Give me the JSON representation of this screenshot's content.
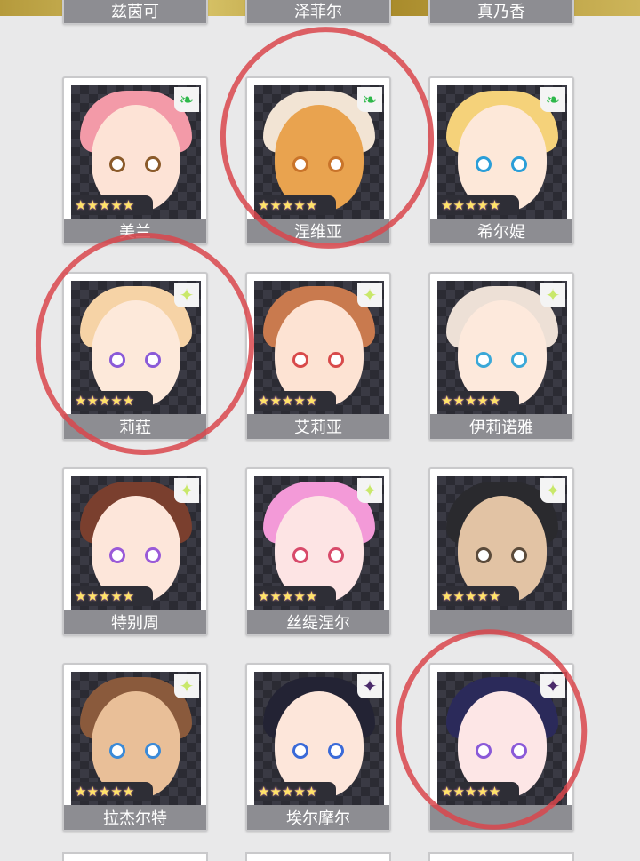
{
  "colors": {
    "card_bg": "#ffffff",
    "name_bar": "#8d8d92",
    "rarity_bar": "#2e2e36",
    "star": "#ffe36a",
    "annotation_circle": "#d9464c",
    "wind_icon": "#2db84a",
    "light_icon": "#d8f07a",
    "dark_icon": "#4a2a6a"
  },
  "rows": [
    {
      "cards": [
        {
          "name": "兹茵可",
          "stars": "★★★★★"
        },
        {
          "name": "泽菲尔",
          "stars": "★★★★★"
        },
        {
          "name": "真乃香",
          "stars": "★★★★★"
        }
      ]
    },
    {
      "cards": [
        {
          "name": "美兰",
          "stars": "★★★★★",
          "element": "wind",
          "element_glyph": "❧",
          "hair": "#f39aa8",
          "face": "#fde3d6"
        },
        {
          "name": "涅维亚",
          "stars": "★★★★★",
          "element": "wind",
          "element_glyph": "❧",
          "hair": "#f2e4d4",
          "face": "#e9a34f"
        },
        {
          "name": "希尔媞",
          "stars": "★★★★★",
          "element": "wind",
          "element_glyph": "❧",
          "hair": "#f5d27a",
          "face": "#fde8d9"
        }
      ]
    },
    {
      "cards": [
        {
          "name": "莉菈",
          "stars": "★★★★★",
          "element": "light",
          "element_glyph": "✦",
          "hair": "#f6d3a6",
          "face": "#fde9da"
        },
        {
          "name": "艾莉亚",
          "stars": "★★★★★",
          "element": "light",
          "element_glyph": "✦",
          "hair": "#c97a4e",
          "face": "#fde3d3"
        },
        {
          "name": "伊莉诺雅",
          "stars": "★★★★★",
          "element": "light",
          "element_glyph": "✦",
          "hair": "#ede0d6",
          "face": "#fde9dc"
        }
      ]
    },
    {
      "cards": [
        {
          "name": "特别周",
          "stars": "★★★★★",
          "element": "light",
          "element_glyph": "✦",
          "hair": "#7a3f2e",
          "face": "#fde6da"
        },
        {
          "name": "丝缇涅尔",
          "stars": "★★★★★",
          "element": "light",
          "element_glyph": "✦",
          "hair": "#f39ad8",
          "face": "#fde4e4"
        },
        {
          "name": "",
          "stars": "★★★★★",
          "element": "light",
          "element_glyph": "✦",
          "hair": "#2a2a2e",
          "face": "#e2c3a4"
        }
      ]
    },
    {
      "cards": [
        {
          "name": "拉杰尔特",
          "stars": "★★★★★",
          "element": "light",
          "element_glyph": "✦",
          "hair": "#8a5a3c",
          "face": "#e9bf98"
        },
        {
          "name": "埃尔摩尔",
          "stars": "★★★★★",
          "element": "dark",
          "element_glyph": "✦",
          "hair": "#232334",
          "face": "#fde6da"
        },
        {
          "name": "",
          "stars": "★★★★★",
          "element": "dark",
          "element_glyph": "✦",
          "hair": "#2b2a5a",
          "face": "#fde6e6"
        }
      ]
    }
  ]
}
